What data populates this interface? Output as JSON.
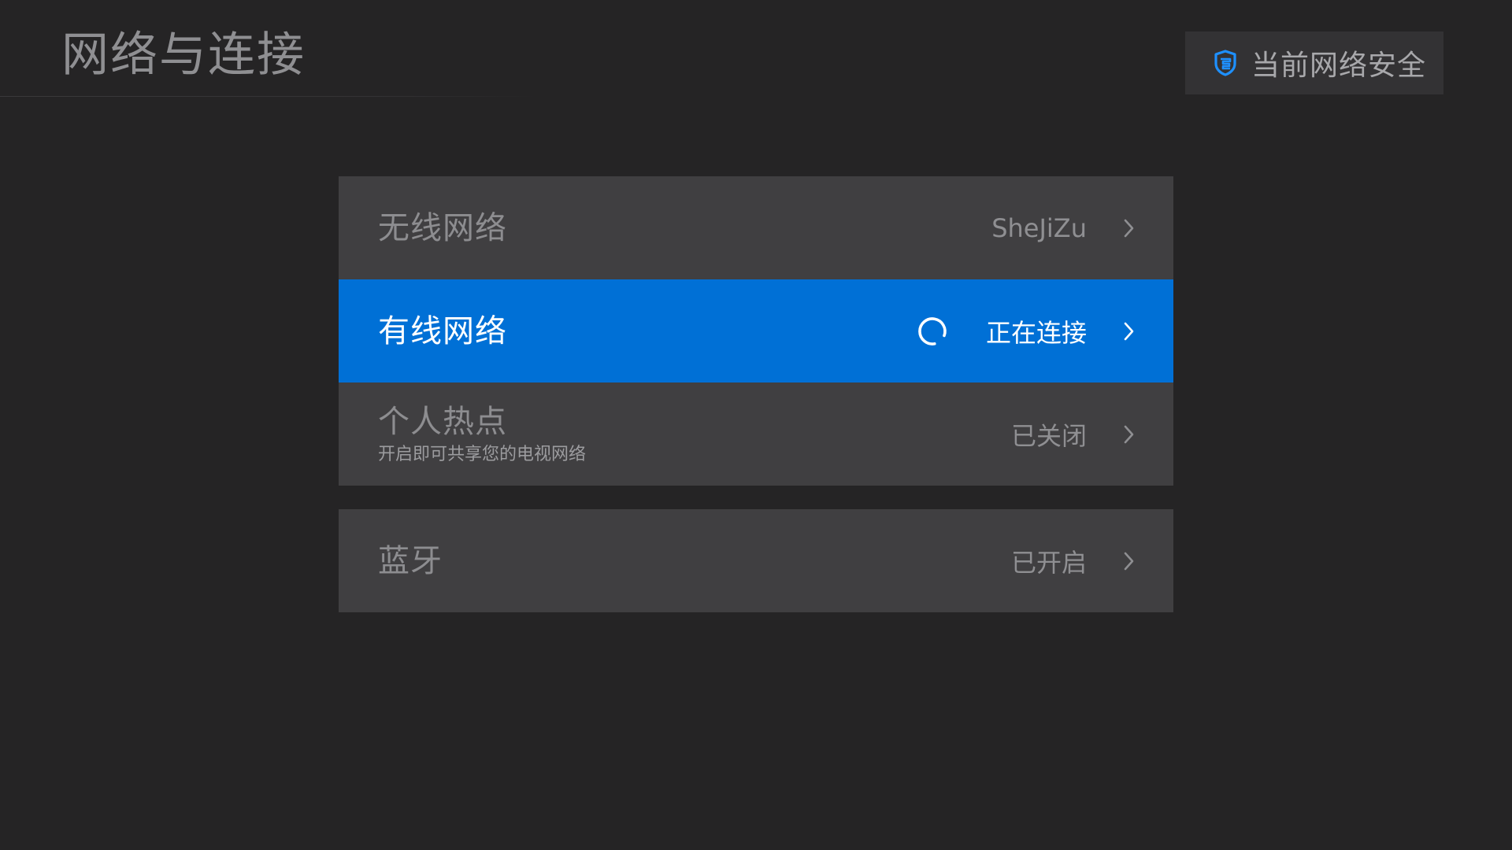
{
  "page": {
    "title": "网络与连接"
  },
  "security_badge": {
    "icon": "shield-icon",
    "label": "当前网络安全",
    "accent_color": "#1e90ff"
  },
  "settings": {
    "items": [
      {
        "label": "无线网络",
        "value": "SheJiZu",
        "subtitle": "",
        "state": "normal",
        "icon": "chevron-right-icon"
      },
      {
        "label": "有线网络",
        "value": "正在连接",
        "subtitle": "",
        "state": "focused",
        "loading": true,
        "icon": "chevron-right-icon"
      },
      {
        "label": "个人热点",
        "value": "已关闭",
        "subtitle": "开启即可共享您的电视网络",
        "state": "normal",
        "icon": "chevron-right-icon"
      },
      {
        "label": "蓝牙",
        "value": "已开启",
        "subtitle": "",
        "state": "normal",
        "icon": "chevron-right-icon"
      }
    ]
  },
  "colors": {
    "background": "#252425",
    "row_background": "#403f41",
    "focus_background": "#0070d6",
    "text_muted": "#8d8d90",
    "text_active": "#ffffff"
  }
}
